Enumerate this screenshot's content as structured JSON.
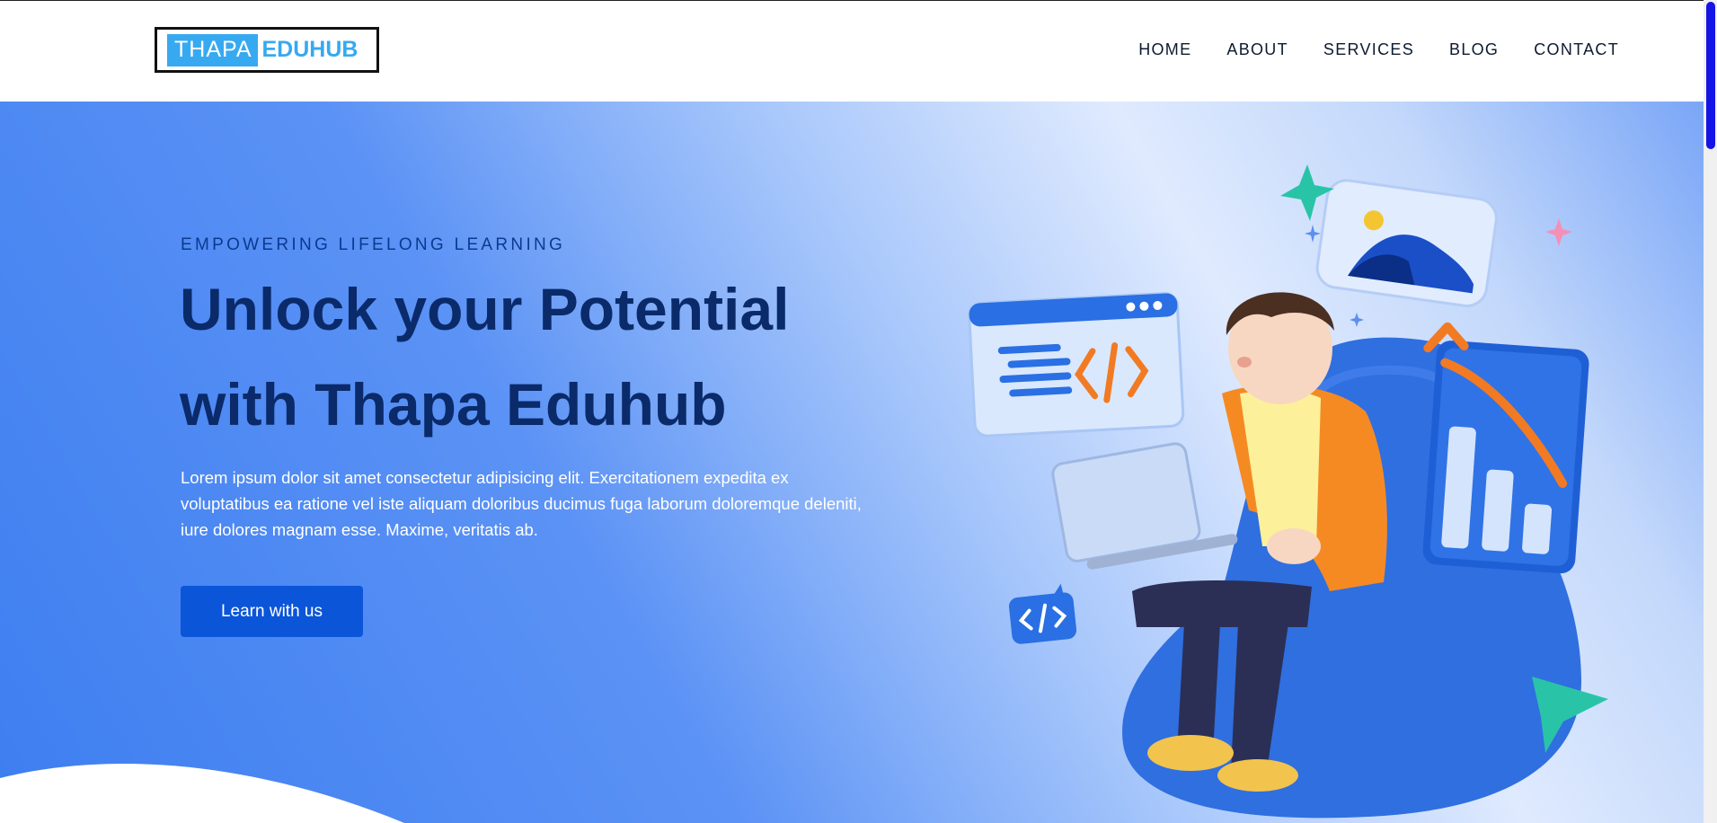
{
  "logo": {
    "part1": "THAPA",
    "part2": "EDUHUB"
  },
  "nav": [
    "HOME",
    "ABOUT",
    "SERVICES",
    "BLOG",
    "CONTACT"
  ],
  "hero": {
    "eyebrow": "EMPOWERING LIFELONG LEARNING",
    "headline_line1": "Unlock your Potential",
    "headline_line2": "with Thapa Eduhub",
    "description": "Lorem ipsum dolor sit amet consectetur adipisicing elit. Exercitationem expedita ex voluptatibus ea ratione vel iste aliquam doloribus ducimus fuga laborum doloremque deleniti, iure dolores magnam esse. Maxime, veritatis ab.",
    "cta_label": "Learn with us"
  },
  "colors": {
    "logo_accent": "#37a9f0",
    "headline": "#0a2a6a",
    "cta": "#0b55d8",
    "scroll_thumb": "#1414e6"
  },
  "icons": [
    "code-window-icon",
    "image-card-icon",
    "chart-card-icon",
    "code-bubble-icon",
    "paper-plane-icon",
    "star-icon"
  ]
}
